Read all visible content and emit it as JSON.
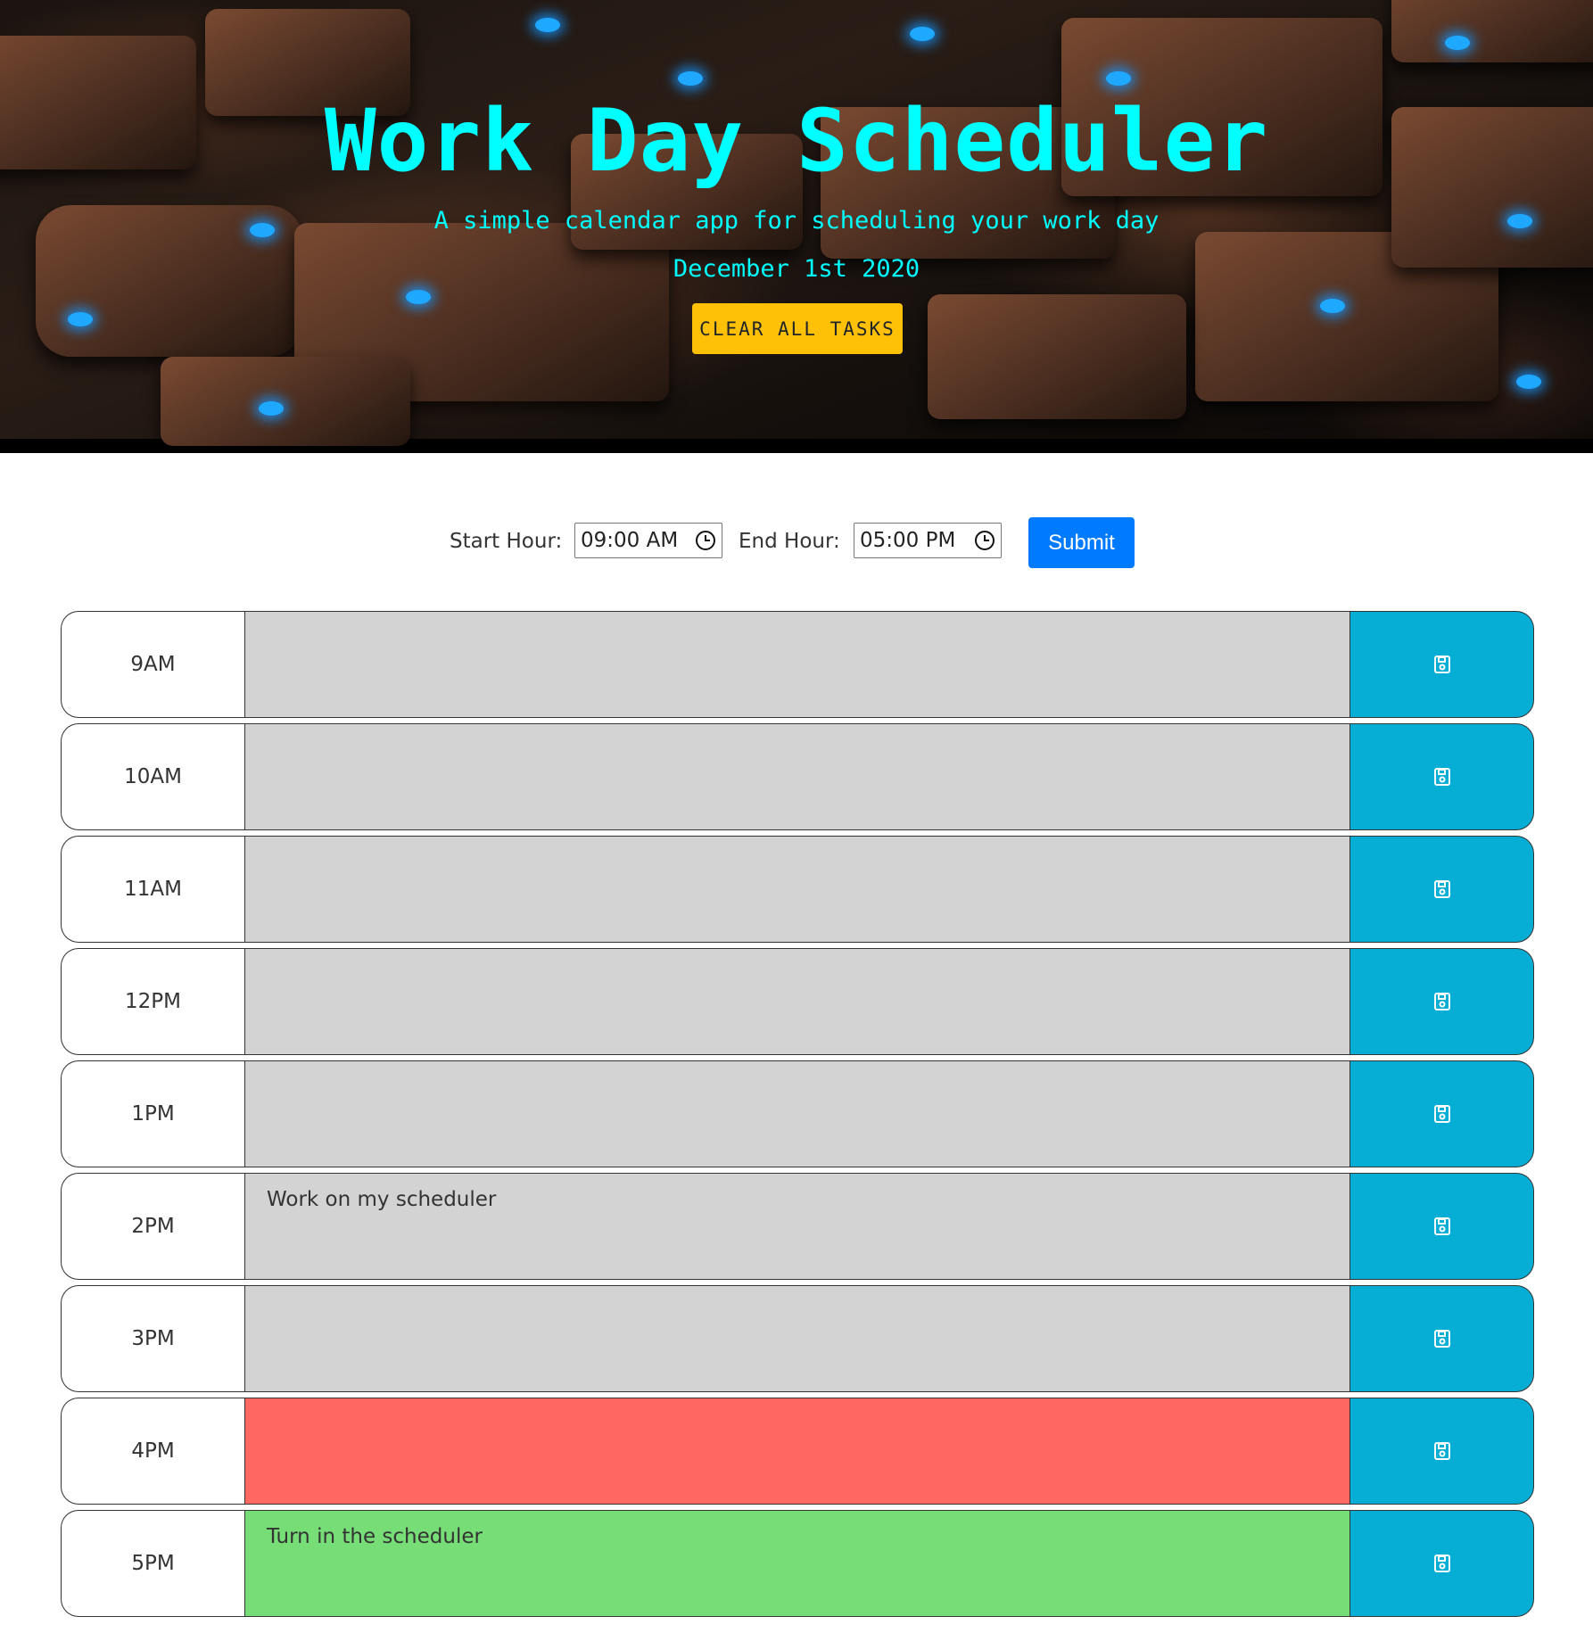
{
  "header": {
    "title": "Work Day Scheduler",
    "lead": "A simple calendar app for scheduling your work day",
    "date": "December 1st 2020",
    "clear_label": "CLEAR ALL TASKS"
  },
  "range_form": {
    "start_label": "Start Hour:",
    "start_value": "09:00 AM",
    "end_label": "End Hour:",
    "end_value": "05:00 PM",
    "submit_label": "Submit"
  },
  "colors": {
    "title": "#00ffff",
    "clear_button": "#ffc107",
    "submit_button": "#007bff",
    "save_button": "#06aed5",
    "past": "#d3d3d3",
    "present": "#ff6961",
    "future": "#77dd77"
  },
  "time_blocks": [
    {
      "hour": "9AM",
      "task": "",
      "state": "past",
      "icon": "save-icon"
    },
    {
      "hour": "10AM",
      "task": "",
      "state": "past",
      "icon": "save-icon"
    },
    {
      "hour": "11AM",
      "task": "",
      "state": "past",
      "icon": "save-icon"
    },
    {
      "hour": "12PM",
      "task": "",
      "state": "past",
      "icon": "save-icon"
    },
    {
      "hour": "1PM",
      "task": "",
      "state": "past",
      "icon": "save-icon"
    },
    {
      "hour": "2PM",
      "task": "Work on my scheduler",
      "state": "past",
      "icon": "save-icon"
    },
    {
      "hour": "3PM",
      "task": "",
      "state": "past",
      "icon": "save-icon"
    },
    {
      "hour": "4PM",
      "task": "",
      "state": "present",
      "icon": "save-icon"
    },
    {
      "hour": "5PM",
      "task": "Turn in the scheduler",
      "state": "future",
      "icon": "save-icon"
    }
  ]
}
